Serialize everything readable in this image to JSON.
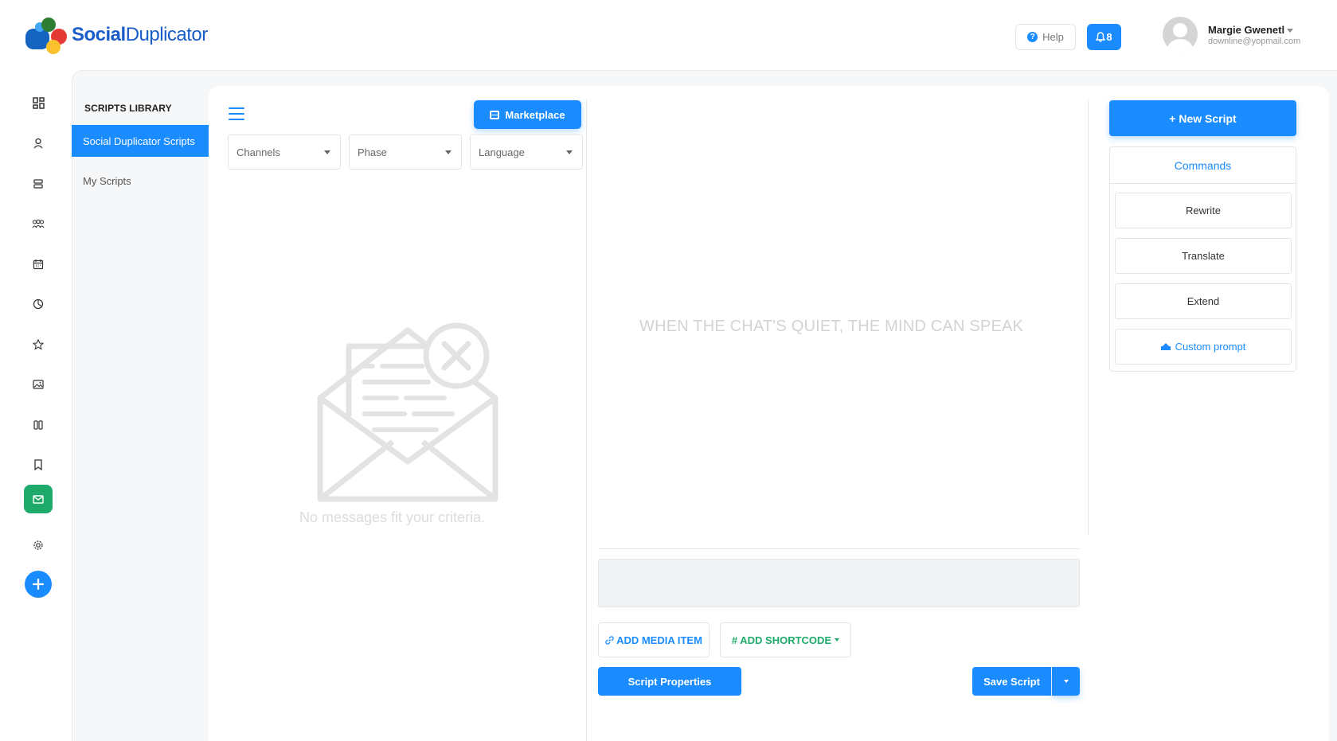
{
  "brand": {
    "name_bold": "Social",
    "name_regular": "Duplicator"
  },
  "header": {
    "help_label": "Help",
    "notification_count": "8",
    "user_name": "Margie Gwenetl",
    "user_email": "downline@yopmail.com"
  },
  "rail": {
    "icons": [
      "dashboard-icon",
      "user-icon",
      "server-icon",
      "group-icon",
      "calendar-icon",
      "chart-pie-icon",
      "star-icon",
      "image-icon",
      "columns-icon",
      "bookmark-icon",
      "mail-icon",
      "settings-icon",
      "plus-icon"
    ],
    "active": "mail-icon",
    "accent_color": "#1eaa6a"
  },
  "library": {
    "title": "SCRIPTS LIBRARY",
    "items": [
      "Social Duplicator Scripts",
      "My Scripts"
    ],
    "active_index": 0
  },
  "toolbar": {
    "marketplace_label": "Marketplace"
  },
  "filters": [
    {
      "placeholder": "Channels"
    },
    {
      "placeholder": "Phase"
    },
    {
      "placeholder": "Language"
    }
  ],
  "list": {
    "empty_message": "No messages fit your criteria."
  },
  "editor": {
    "quote": "WHEN THE CHAT'S QUIET, THE MIND CAN SPEAK",
    "add_media_label": "ADD MEDIA ITEM",
    "add_shortcode_label": "# ADD SHORTCODE",
    "script_properties_label": "Script Properties",
    "save_label": "Save Script"
  },
  "right_panel": {
    "new_script_label": "+ New Script",
    "commands_title": "Commands",
    "commands": [
      "Rewrite",
      "Translate",
      "Extend",
      "Custom prompt"
    ]
  },
  "colors": {
    "primary": "#1a8cff",
    "success": "#1eaa6a",
    "muted_text": "#d3d3d3"
  }
}
